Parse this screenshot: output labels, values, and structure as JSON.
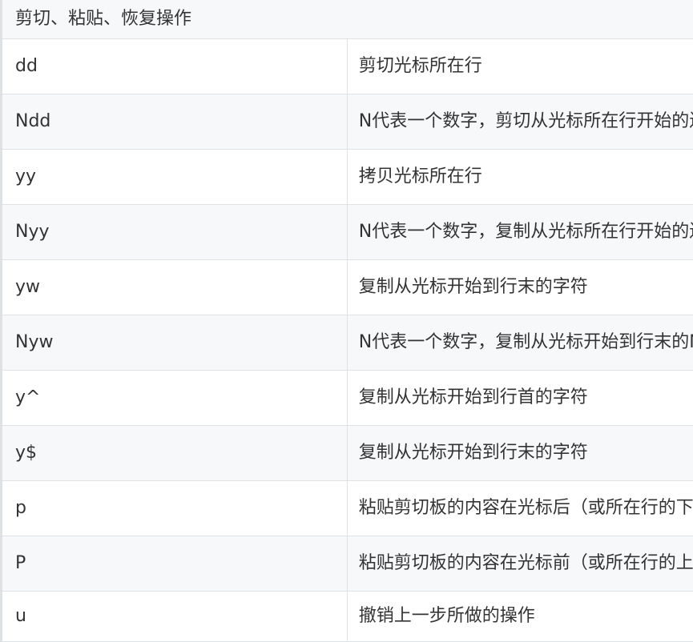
{
  "table": {
    "title": "剪切、粘贴、恢复操作",
    "rows": [
      {
        "command": "dd",
        "description": "剪切光标所在行"
      },
      {
        "command": "Ndd",
        "description": "N代表一个数字，剪切从光标所在行开始的连续N行"
      },
      {
        "command": "yy",
        "description": "拷贝光标所在行"
      },
      {
        "command": "Nyy",
        "description": "N代表一个数字，复制从光标所在行开始的连续N行"
      },
      {
        "command": "yw",
        "description": "复制从光标开始到行末的字符"
      },
      {
        "command": "Nyw",
        "description": "N代表一个数字，复制从光标开始到行末的N个单词"
      },
      {
        "command": "y^",
        "description": "复制从光标开始到行首的字符"
      },
      {
        "command": "y$",
        "description": "复制从光标开始到行末的字符"
      },
      {
        "command": "p",
        "description": "粘贴剪切板的内容在光标后（或所在行的下一行，针对整行复制）"
      },
      {
        "command": "P",
        "description": "粘贴剪切板的内容在光标前（或所在行的上一行，针对整行复制）"
      },
      {
        "command": "u",
        "description": "撤销上一步所做的操作"
      }
    ]
  }
}
